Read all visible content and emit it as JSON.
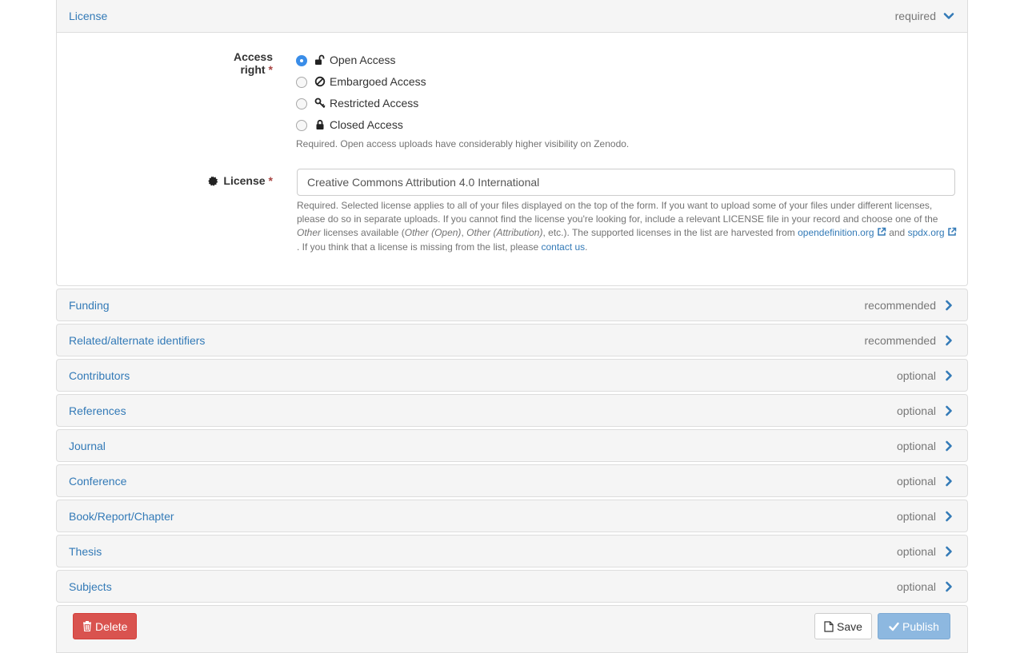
{
  "license_panel": {
    "title": "License",
    "requirement": "required",
    "access_right": {
      "label": "Access right",
      "required_mark": "*",
      "options": [
        {
          "label": "Open Access",
          "icon": "unlock-icon",
          "checked": true
        },
        {
          "label": "Embargoed Access",
          "icon": "ban-icon",
          "checked": false
        },
        {
          "label": "Restricted Access",
          "icon": "key-icon",
          "checked": false
        },
        {
          "label": "Closed Access",
          "icon": "lock-icon",
          "checked": false
        }
      ],
      "help": "Required. Open access uploads have considerably higher visibility on Zenodo."
    },
    "license": {
      "label": "License",
      "required_mark": "*",
      "value": "Creative Commons Attribution 4.0 International",
      "help_1": "Required. Selected license applies to all of your files displayed on the top of the form. If you want to upload some of your files under different licenses, please do so in separate uploads. If you cannot find the license you're looking for, include a relevant LICENSE file in your record and choose one of the ",
      "help_other": "Other",
      "help_2": " licenses available (",
      "help_other_open": "Other (Open)",
      "help_3": ", ",
      "help_other_attr": "Other (Attribution)",
      "help_4": ", etc.). The supported licenses in the list are harvested from ",
      "link_opendefinition": "opendefinition.org",
      "help_5": " and ",
      "link_spdx": "spdx.org",
      "help_6": ". If you think that a license is missing from the list, please ",
      "link_contact": "contact us",
      "help_7": "."
    }
  },
  "sections": [
    {
      "title": "Funding",
      "requirement": "recommended"
    },
    {
      "title": "Related/alternate identifiers",
      "requirement": "recommended"
    },
    {
      "title": "Contributors",
      "requirement": "optional"
    },
    {
      "title": "References",
      "requirement": "optional"
    },
    {
      "title": "Journal",
      "requirement": "optional"
    },
    {
      "title": "Conference",
      "requirement": "optional"
    },
    {
      "title": "Book/Report/Chapter",
      "requirement": "optional"
    },
    {
      "title": "Thesis",
      "requirement": "optional"
    },
    {
      "title": "Subjects",
      "requirement": "optional"
    }
  ],
  "actions": {
    "delete_label": "Delete",
    "save_label": "Save",
    "publish_label": "Publish"
  },
  "colors": {
    "link": "#337ab7",
    "danger": "#d9534f",
    "primary_disabled": "#8db8e0",
    "required": "#a94442"
  }
}
